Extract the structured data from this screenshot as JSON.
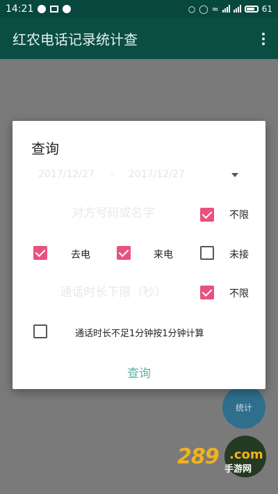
{
  "status_bar": {
    "time": "14:21",
    "battery": "61"
  },
  "app": {
    "title": "红农电话记录统计查"
  },
  "dialog": {
    "title": "查询",
    "date_start": "2017/12/27",
    "date_separator": "–",
    "date_end": "2017/12/27",
    "name_placeholder": "对方号码或名字",
    "name_unlimited_label": "不限",
    "outgoing_label": "去电",
    "incoming_label": "来电",
    "missed_label": "未接",
    "duration_placeholder": "通话时长下限（秒）",
    "duration_unlimited_label": "不限",
    "round_minute_label": "通话时长不足1分钟按1分钟计算",
    "query_button": "查询"
  },
  "checkboxes": {
    "name_unlimited": true,
    "outgoing": true,
    "incoming": true,
    "missed": false,
    "duration_unlimited": true,
    "round_minute": false
  },
  "fab": {
    "label": "统计"
  },
  "watermark": {
    "brand": "289",
    "domain": ".com",
    "sub": "手游网"
  },
  "colors": {
    "primary": "#0a4e43",
    "accent": "#e8527f",
    "query": "#5fb0a6",
    "fab": "#2f6f8d"
  }
}
